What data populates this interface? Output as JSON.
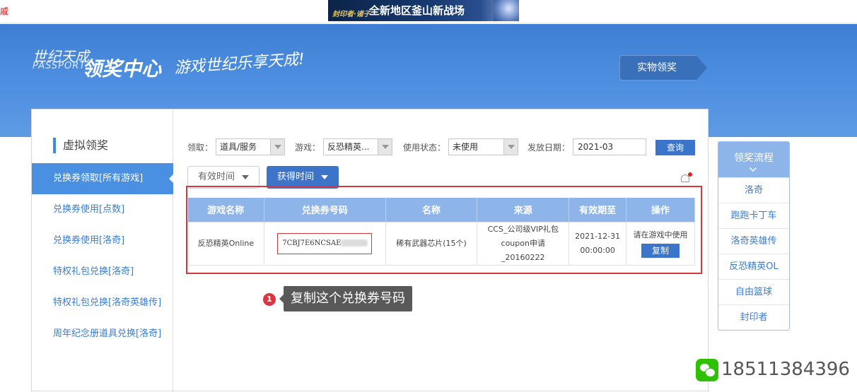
{
  "topbar": {
    "edge_char": "戚",
    "ad_logo": "封印者·诸子",
    "ad_text": "全新地区釜山新战场"
  },
  "header": {
    "brand_cn": "世纪天成",
    "brand_en": "PASSPORT",
    "brand_title": "领奖中心",
    "slogan": "游戏世纪乐享天成!",
    "physical_button": "实物领奖"
  },
  "sidebar": {
    "title": "虚拟领奖",
    "items": [
      {
        "label": "兑换券领取[所有游戏]",
        "active": true
      },
      {
        "label": "兑换券使用[点数]"
      },
      {
        "label": "兑换券使用[洛奇]"
      },
      {
        "label": "特权礼包兑换[洛奇]"
      },
      {
        "label": "特权礼包兑换[洛奇英雄传]"
      },
      {
        "label": "周年纪念册道具兑换[洛奇]"
      }
    ]
  },
  "filters": {
    "claim_label": "领取：",
    "claim_value": "道具/服务",
    "game_label": "游戏：",
    "game_value": "反恐精英...",
    "status_label": "使用状态：",
    "status_value": "未使用",
    "date_label": "发放日期：",
    "date_value": "2021-03",
    "query_button": "查询"
  },
  "sort": {
    "valid_time": "有效时间",
    "obtain_time": "获得时间"
  },
  "table": {
    "headers": [
      "游戏名称",
      "兑换券号码",
      "名称",
      "来源",
      "有效期至",
      "操作"
    ],
    "rows": [
      {
        "game": "反恐精英Online",
        "code": "7CBJ7E6NCSAE",
        "name": "稀有武器芯片(15个)",
        "source": "CCS_公司级VIP礼包coupon申请_20160222",
        "expires": "2021-12-31 00:00:00",
        "action_text": "请在游戏中使用",
        "copy_button": "复制"
      }
    ]
  },
  "tip": {
    "number": "1",
    "text": "复制这个兑换券号码"
  },
  "process": {
    "title": "领奖流程",
    "items": [
      "洛奇",
      "跑跑卡丁车",
      "洛奇英雄传",
      "反恐精英OL",
      "自由篮球",
      "封印者"
    ]
  },
  "watermark": {
    "phone": "18511384396"
  },
  "colors": {
    "primary": "#3b74c8",
    "hero": "#4d8ee0",
    "highlight": "#d9363e",
    "table_header": "#8eb5ea"
  }
}
